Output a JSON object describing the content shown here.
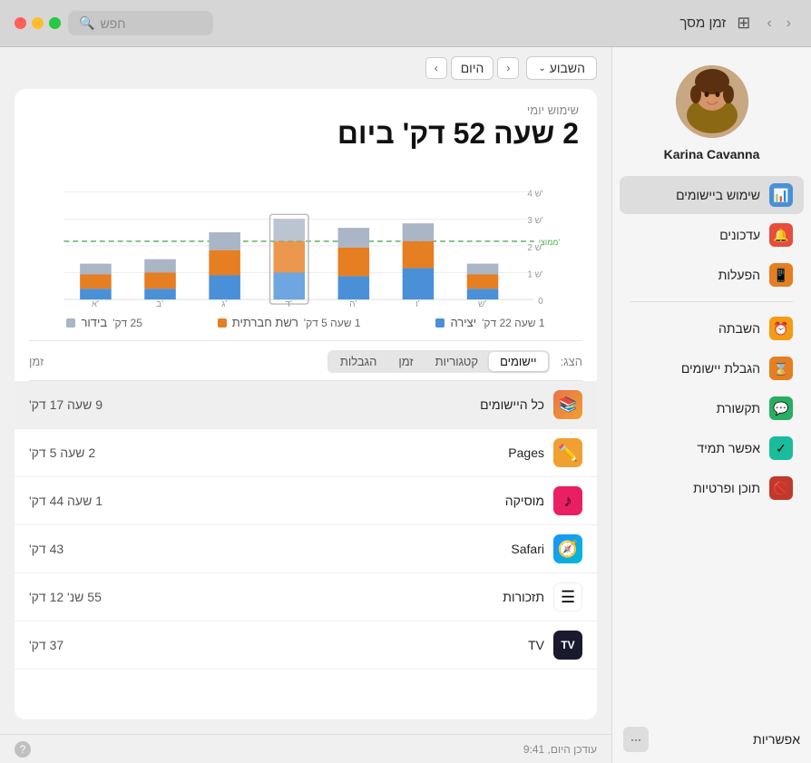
{
  "topbar": {
    "search_placeholder": "חפש",
    "window_title": "זמן מסך",
    "grid_icon": "⊞",
    "nav_back": "‹",
    "nav_forward": "›"
  },
  "traffic_lights": {
    "close": "#ff5f57",
    "minimize": "#ffbd2e",
    "maximize": "#28c840"
  },
  "subtoolbar": {
    "week_label": "השבוע",
    "today_label": "היום",
    "nav_back": "‹",
    "nav_forward": "›"
  },
  "stats": {
    "subtitle": "שימוש יומי",
    "title": "2 שעה 52 דק' ביום"
  },
  "chart": {
    "days": [
      "א'",
      "ב'",
      "ג'",
      "ד'",
      "ה'",
      "ו'",
      "ש'"
    ],
    "y_labels": [
      "0",
      "1 ש'",
      "2 ש'",
      "3 ש'",
      "4 ש'"
    ],
    "avg_label": "ממוצי'"
  },
  "legend": {
    "items": [
      {
        "label": "יצירה",
        "color": "#4a90d9",
        "value": "1 שעה 22 דק'"
      },
      {
        "label": "רשת חברתית",
        "color": "#e67e22",
        "value": "1 שעה 5 דק'"
      },
      {
        "label": "בידור",
        "color": "#aab5c5",
        "value": "25 דק'"
      }
    ]
  },
  "table": {
    "header_label": "הצג:",
    "tabs": [
      "יישומים",
      "קטגוריות",
      "זמן",
      "הגבלות"
    ],
    "active_tab": "יישומים",
    "col_time": "זמן"
  },
  "app_rows": [
    {
      "name": "כל היישומים",
      "time": "9 שעה 17 דק'",
      "icon": "📚",
      "icon_bg": "#e8734a"
    },
    {
      "name": "Pages",
      "time": "2 שעה 5 דק'",
      "icon": "📝",
      "icon_bg": "#f0a030"
    },
    {
      "name": "מוסיקה",
      "time": "1 שעה 44 דק'",
      "icon": "♪",
      "icon_bg": "#e91e63"
    },
    {
      "name": "Safari",
      "time": "43 דק'",
      "icon": "🧭",
      "icon_bg": "#1e90ff"
    },
    {
      "name": "תזכורות",
      "time": "55 שנ' 12 דק'",
      "icon": "☰",
      "icon_bg": "#ff6b6b"
    },
    {
      "name": "TV",
      "time": "37 דק'",
      "icon": "📺",
      "icon_bg": "#1a1a2e"
    }
  ],
  "statusbar": {
    "updated": "עודכן היום, 9:41",
    "help_label": "?"
  },
  "sidebar": {
    "user_name": "Karina Cavanna",
    "menu_items": [
      {
        "label": "שימוש ביישומים",
        "icon": "📊",
        "icon_bg": "#4a90d9",
        "active": true
      },
      {
        "label": "עדכונים",
        "icon": "🔔",
        "icon_bg": "#e74c3c",
        "active": false
      },
      {
        "label": "הפעלות",
        "icon": "📱",
        "icon_bg": "#e67e22",
        "active": false
      },
      {
        "label": "השבתה",
        "icon": "⏰",
        "icon_bg": "#f39c12",
        "active": false
      },
      {
        "label": "הגבלת יישומים",
        "icon": "⌛",
        "icon_bg": "#e67e22",
        "active": false
      },
      {
        "label": "תקשורת",
        "icon": "💬",
        "icon_bg": "#27ae60",
        "active": false
      },
      {
        "label": "אפשר תמיד",
        "icon": "✓",
        "icon_bg": "#27ae60",
        "active": false
      },
      {
        "label": "תוכן ופרטיות",
        "icon": "🚫",
        "icon_bg": "#c0392b",
        "active": false
      }
    ],
    "permissions_label": "אפשריות",
    "more_icon": "···"
  }
}
